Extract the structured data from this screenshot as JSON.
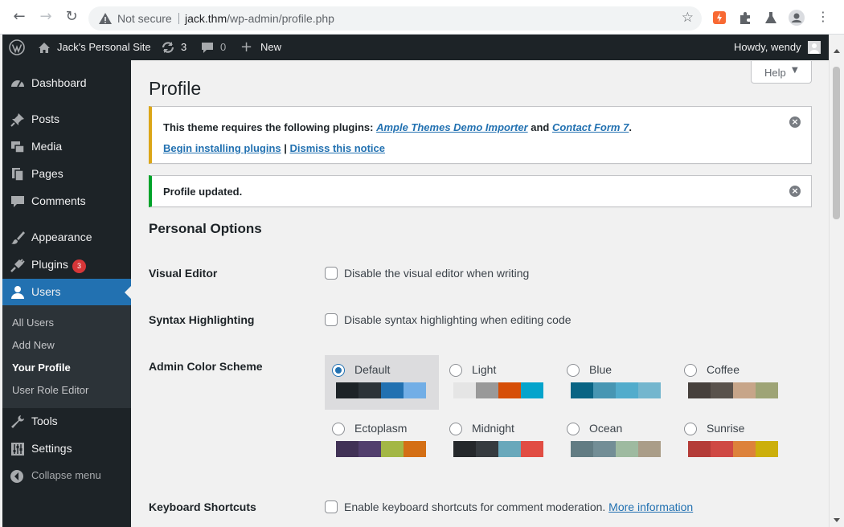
{
  "browser": {
    "security_label": "Not secure",
    "url_host": "jack.thm",
    "url_path": "/wp-admin/profile.php"
  },
  "adminbar": {
    "site_name": "Jack's Personal Site",
    "updates_count": "3",
    "comments_count": "0",
    "new_label": "New",
    "howdy": "Howdy, wendy"
  },
  "sidebar": {
    "dashboard": "Dashboard",
    "posts": "Posts",
    "media": "Media",
    "pages": "Pages",
    "comments": "Comments",
    "appearance": "Appearance",
    "plugins": "Plugins",
    "plugins_badge": "3",
    "users": "Users",
    "submenu": [
      "All Users",
      "Add New",
      "Your Profile",
      "User Role Editor"
    ],
    "tools": "Tools",
    "settings": "Settings",
    "collapse": "Collapse menu"
  },
  "page": {
    "help_label": "Help",
    "title": "Profile",
    "warning_notice": {
      "prefix": "This theme requires the following plugins: ",
      "plugin1": "Ample Themes Demo Importer",
      "and": " and ",
      "plugin2": "Contact Form 7",
      "suffix": ".",
      "install_link": "Begin installing plugins",
      "separator": " | ",
      "dismiss_link": "Dismiss this notice"
    },
    "success_notice": "Profile updated.",
    "personal_options_title": "Personal Options",
    "visual_editor_label": "Visual Editor",
    "visual_editor_option": "Disable the visual editor when writing",
    "syntax_label": "Syntax Highlighting",
    "syntax_option": "Disable syntax highlighting when editing code",
    "color_scheme_label": "Admin Color Scheme",
    "color_schemes": [
      {
        "name": "Default",
        "selected": true,
        "colors": [
          "#1d2327",
          "#2c3338",
          "#2271b1",
          "#72aee6"
        ]
      },
      {
        "name": "Light",
        "selected": false,
        "colors": [
          "#e5e5e5",
          "#999999",
          "#d64e07",
          "#04a4cc"
        ]
      },
      {
        "name": "Blue",
        "selected": false,
        "colors": [
          "#096484",
          "#4796b3",
          "#52accc",
          "#74b6ce"
        ]
      },
      {
        "name": "Coffee",
        "selected": false,
        "colors": [
          "#46403c",
          "#59524c",
          "#c7a589",
          "#9ea476"
        ]
      },
      {
        "name": "Ectoplasm",
        "selected": false,
        "colors": [
          "#413256",
          "#523f6d",
          "#a3b745",
          "#d46f15"
        ]
      },
      {
        "name": "Midnight",
        "selected": false,
        "colors": [
          "#25282b",
          "#363b3f",
          "#69a8bb",
          "#e14d43"
        ]
      },
      {
        "name": "Ocean",
        "selected": false,
        "colors": [
          "#627c83",
          "#738e96",
          "#9ebaa0",
          "#aa9d88"
        ]
      },
      {
        "name": "Sunrise",
        "selected": false,
        "colors": [
          "#b43c38",
          "#cf4944",
          "#dd823b",
          "#ccaf0b"
        ]
      }
    ],
    "keyboard_label": "Keyboard Shortcuts",
    "keyboard_option": "Enable keyboard shortcuts for comment moderation.",
    "more_info": "More information"
  }
}
